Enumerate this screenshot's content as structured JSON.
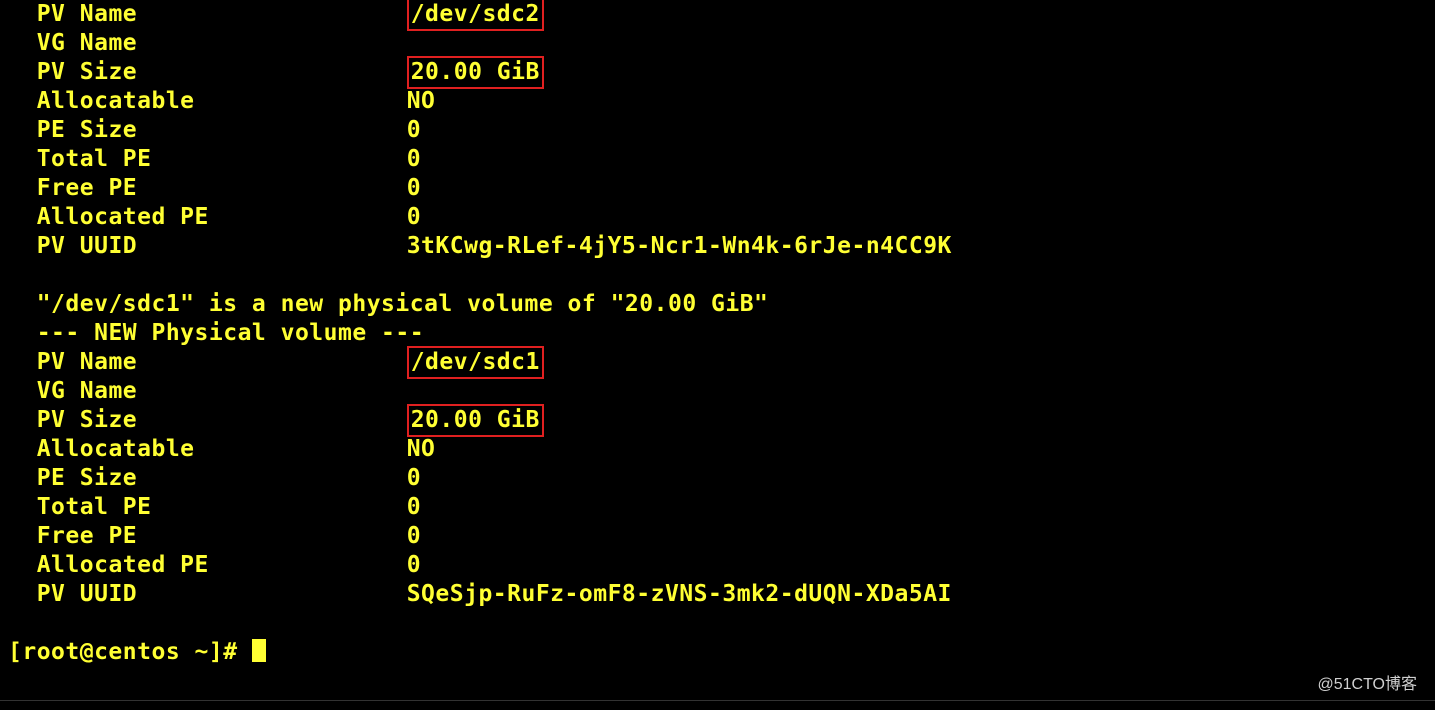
{
  "pv1": {
    "name_label": "PV Name",
    "name_value": "/dev/sdc2",
    "vg_label": "VG Name",
    "vg_value": "",
    "size_label": "PV Size",
    "size_value": "20.00 GiB",
    "alloc_label": "Allocatable",
    "alloc_value": "NO",
    "pesize_label": "PE Size",
    "pesize_value": "0",
    "totalpe_label": "Total PE",
    "totalpe_value": "0",
    "freepe_label": "Free PE",
    "freepe_value": "0",
    "allocpe_label": "Allocated PE",
    "allocpe_value": "0",
    "uuid_label": "PV UUID",
    "uuid_value": "3tKCwg-RLef-4jY5-Ncr1-Wn4k-6rJe-n4CC9K"
  },
  "message": "\"/dev/sdc1\" is a new physical volume of \"20.00 GiB\"",
  "header2": "--- NEW Physical volume ---",
  "pv2": {
    "name_label": "PV Name",
    "name_value": "/dev/sdc1",
    "vg_label": "VG Name",
    "vg_value": "",
    "size_label": "PV Size",
    "size_value": "20.00 GiB",
    "alloc_label": "Allocatable",
    "alloc_value": "NO",
    "pesize_label": "PE Size",
    "pesize_value": "0",
    "totalpe_label": "Total PE",
    "totalpe_value": "0",
    "freepe_label": "Free PE",
    "freepe_value": "0",
    "allocpe_label": "Allocated PE",
    "allocpe_value": "0",
    "uuid_label": "PV UUID",
    "uuid_value": "SQeSjp-RuFz-omF8-zVNS-3mk2-dUQN-XDa5AI"
  },
  "prompt": "[root@centos ~]# ",
  "watermark": "@51CTO博客"
}
